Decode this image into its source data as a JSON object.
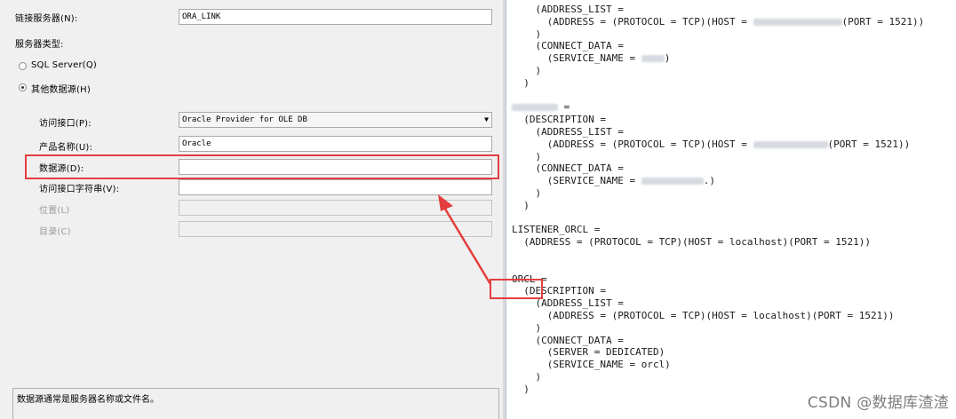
{
  "form": {
    "linked_server_label": "链接服务器(N):",
    "linked_server_value": "ORA_LINK",
    "server_type_label": "服务器类型:",
    "radio_sql_server": "SQL Server(Q)",
    "radio_other": "其他数据源(H)",
    "provider_label": "访问接口(P):",
    "provider_value": "Oracle Provider for OLE DB",
    "product_label": "产品名称(U):",
    "product_value": "Oracle",
    "datasource_label": "数据源(D):",
    "datasource_value": "",
    "provider_string_label": "访问接口字符串(V):",
    "provider_string_value": "",
    "location_label": "位置(L)",
    "catalog_label": "目录(C)",
    "description": "数据源通常是服务器名称或文件名。"
  },
  "editor": {
    "lines": [
      "    (ADDRESS_LIST =",
      "      (ADDRESS = (PROTOCOL = TCP)(HOST = ",
      "    )",
      "    (CONNECT_DATA =",
      "      (SERVICE_NAME = ",
      "    )",
      "  )",
      "",
      " =",
      "  (DESCRIPTION =",
      "    (ADDRESS_LIST =",
      "      (ADDRESS = (PROTOCOL = TCP)(HOST = ",
      "    )",
      "    (CONNECT_DATA =",
      "      (SERVICE_NAME = ",
      "    )",
      "  )",
      "",
      "LISTENER_ORCL =",
      "  (ADDRESS = (PROTOCOL = TCP)(HOST = localhost)(PORT = 1521))",
      "",
      "",
      "ORCL =",
      "  (DESCRIPTION =",
      "    (ADDRESS_LIST =",
      "      (ADDRESS = (PROTOCOL = TCP)(HOST = localhost)(PORT = 1521))",
      "    )",
      "    (CONNECT_DATA =",
      "      (SERVER = DEDICATED)",
      "      (SERVICE_NAME = orcl)",
      "    )",
      "  )"
    ],
    "port_suffix_1": "(PORT = 1521))",
    "service_suffix_1": ")",
    "port_suffix_2": "(PORT = 1521))",
    "service_suffix_2": ".)"
  },
  "watermark": "CSDN @数据库渣渣",
  "colors": {
    "highlight": "#e43e3e",
    "panel": "#f0f0f0"
  }
}
